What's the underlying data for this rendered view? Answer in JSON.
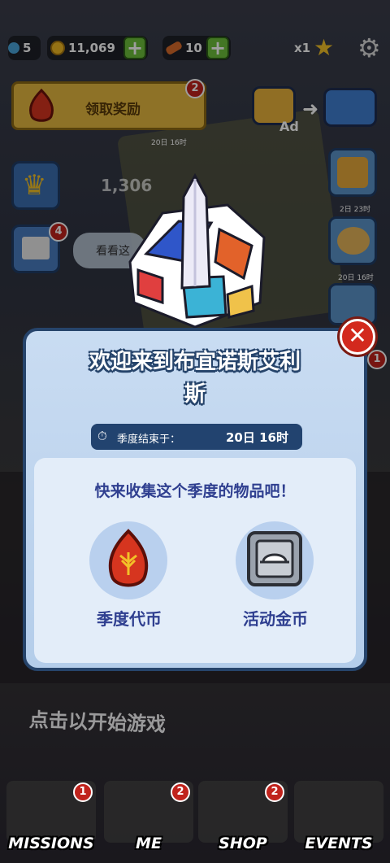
{
  "top_bar": {
    "keys": "5",
    "coins": "11,069",
    "boards": "10",
    "multiplier": "x1"
  },
  "claim_reward": {
    "label": "领取奖励",
    "badge": "2",
    "timer": "20日 16时"
  },
  "leaderboard": {
    "score": "1,306"
  },
  "news": {
    "badge": "4",
    "bubble": "看看这"
  },
  "right_timers": [
    "2日 23时",
    "20日 16时"
  ],
  "right_badge": "1",
  "modal": {
    "title": "欢迎来到布宜诺斯艾利斯",
    "season_label": "季度结束于：",
    "season_time": "20日 16时",
    "collect_title": "快来收集这个季度的物品吧！",
    "items": [
      {
        "label": "季度代币",
        "icon": "season-token-icon"
      },
      {
        "label": "活动金币",
        "icon": "event-coin-icon"
      }
    ],
    "close": "✕"
  },
  "start_text": "点击以开始游戏",
  "nav": [
    {
      "label": "MISSIONS",
      "badge": "1"
    },
    {
      "label": "ME",
      "badge": "2"
    },
    {
      "label": "SHOP",
      "badge": "2"
    },
    {
      "label": "EVENTS",
      "badge": ""
    }
  ],
  "colors": {
    "accent_green": "#6cbf3a",
    "modal_border": "#26446b",
    "badge_red": "#c0231c",
    "text_blue": "#2f3f90"
  }
}
